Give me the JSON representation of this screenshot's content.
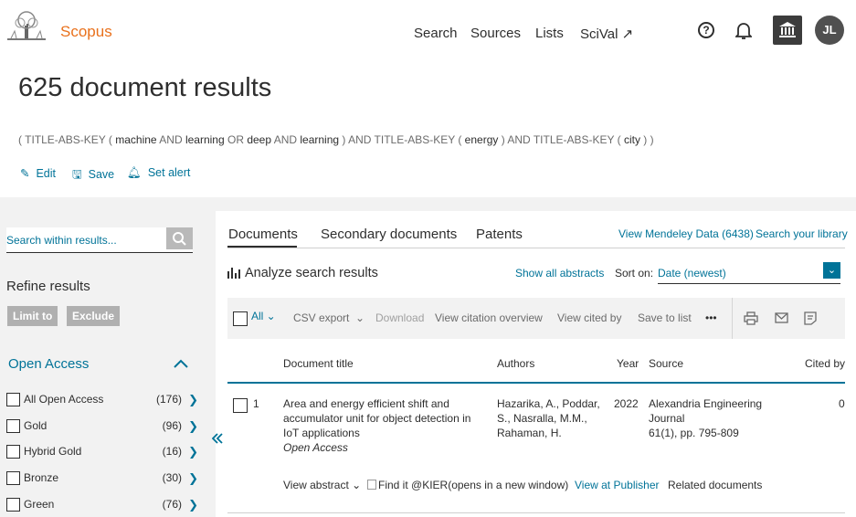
{
  "header": {
    "brand": "Scopus",
    "nav": [
      "Search",
      "Sources",
      "Lists",
      "SciVal ↗"
    ],
    "help_glyph": "?",
    "avatar_initials": "JL"
  },
  "page": {
    "title": "625 document results",
    "query": {
      "p1": "( TITLE-ABS-KEY ( ",
      "t1": "machine",
      "p2": " AND ",
      "t2": "learning",
      "p3": "  OR  ",
      "t3": "deep",
      "p4": "  AND ",
      "t4": "learning",
      "p5": " )  AND  TITLE-ABS-KEY ( ",
      "t5": "energy",
      "p6": " )  AND  TITLE-ABS-KEY ( ",
      "t6": "city",
      "p7": " ) )"
    },
    "actions": {
      "edit": "Edit",
      "save": "Save",
      "set_alert": "Set alert"
    }
  },
  "sidebar": {
    "search_placeholder": "Search within results...",
    "refine_title": "Refine results",
    "limit_to": "Limit to",
    "exclude": "Exclude",
    "open_access_title": "Open Access",
    "facets": [
      {
        "label": "All Open Access",
        "count": "(176)"
      },
      {
        "label": "Gold",
        "count": "(96)"
      },
      {
        "label": "Hybrid Gold",
        "count": "(16)"
      },
      {
        "label": "Bronze",
        "count": "(30)"
      },
      {
        "label": "Green",
        "count": "(76)"
      }
    ]
  },
  "tabs": {
    "documents": "Documents",
    "secondary": "Secondary documents",
    "patents": "Patents",
    "mendeley": "View Mendeley Data (6438)",
    "library": "Search your library"
  },
  "results_bar": {
    "analyze": "Analyze search results",
    "show_all": "Show all abstracts",
    "sort_label": "Sort on:",
    "sort_value": "Date (newest)"
  },
  "toolbar": {
    "all": "All",
    "csv": "CSV export",
    "download": "Download",
    "citation_overview": "View citation overview",
    "cited_by": "View cited by",
    "save_list": "Save to list",
    "more": "•••"
  },
  "table": {
    "columns": [
      "Document title",
      "Authors",
      "Year",
      "Source",
      "Cited by"
    ],
    "rows": [
      {
        "num": "1",
        "title_l1": "Area and energy efficient shift and",
        "title_l2": "accumulator unit for object detection in",
        "title_l3": "IoT applications",
        "access": "Open Access",
        "authors_l1": "Hazarika, A., Poddar,",
        "authors_l2": "S., Nasralla, M.M.,",
        "authors_l3": "Rahaman, H.",
        "year": "2022",
        "source_l1": "Alexandria Engineering",
        "source_l2": "Journal",
        "source_l3": "61(1), pp. 795-809",
        "cited": "0",
        "links": {
          "view_abstract": "View abstract",
          "find_it": "Find it @KIER(opens in a new window)",
          "publisher": "View at Publisher",
          "related": "Related documents"
        }
      }
    ]
  },
  "colors": {
    "accent": "#007398",
    "brand": "#e9711c",
    "band": "#f2f2f2"
  }
}
